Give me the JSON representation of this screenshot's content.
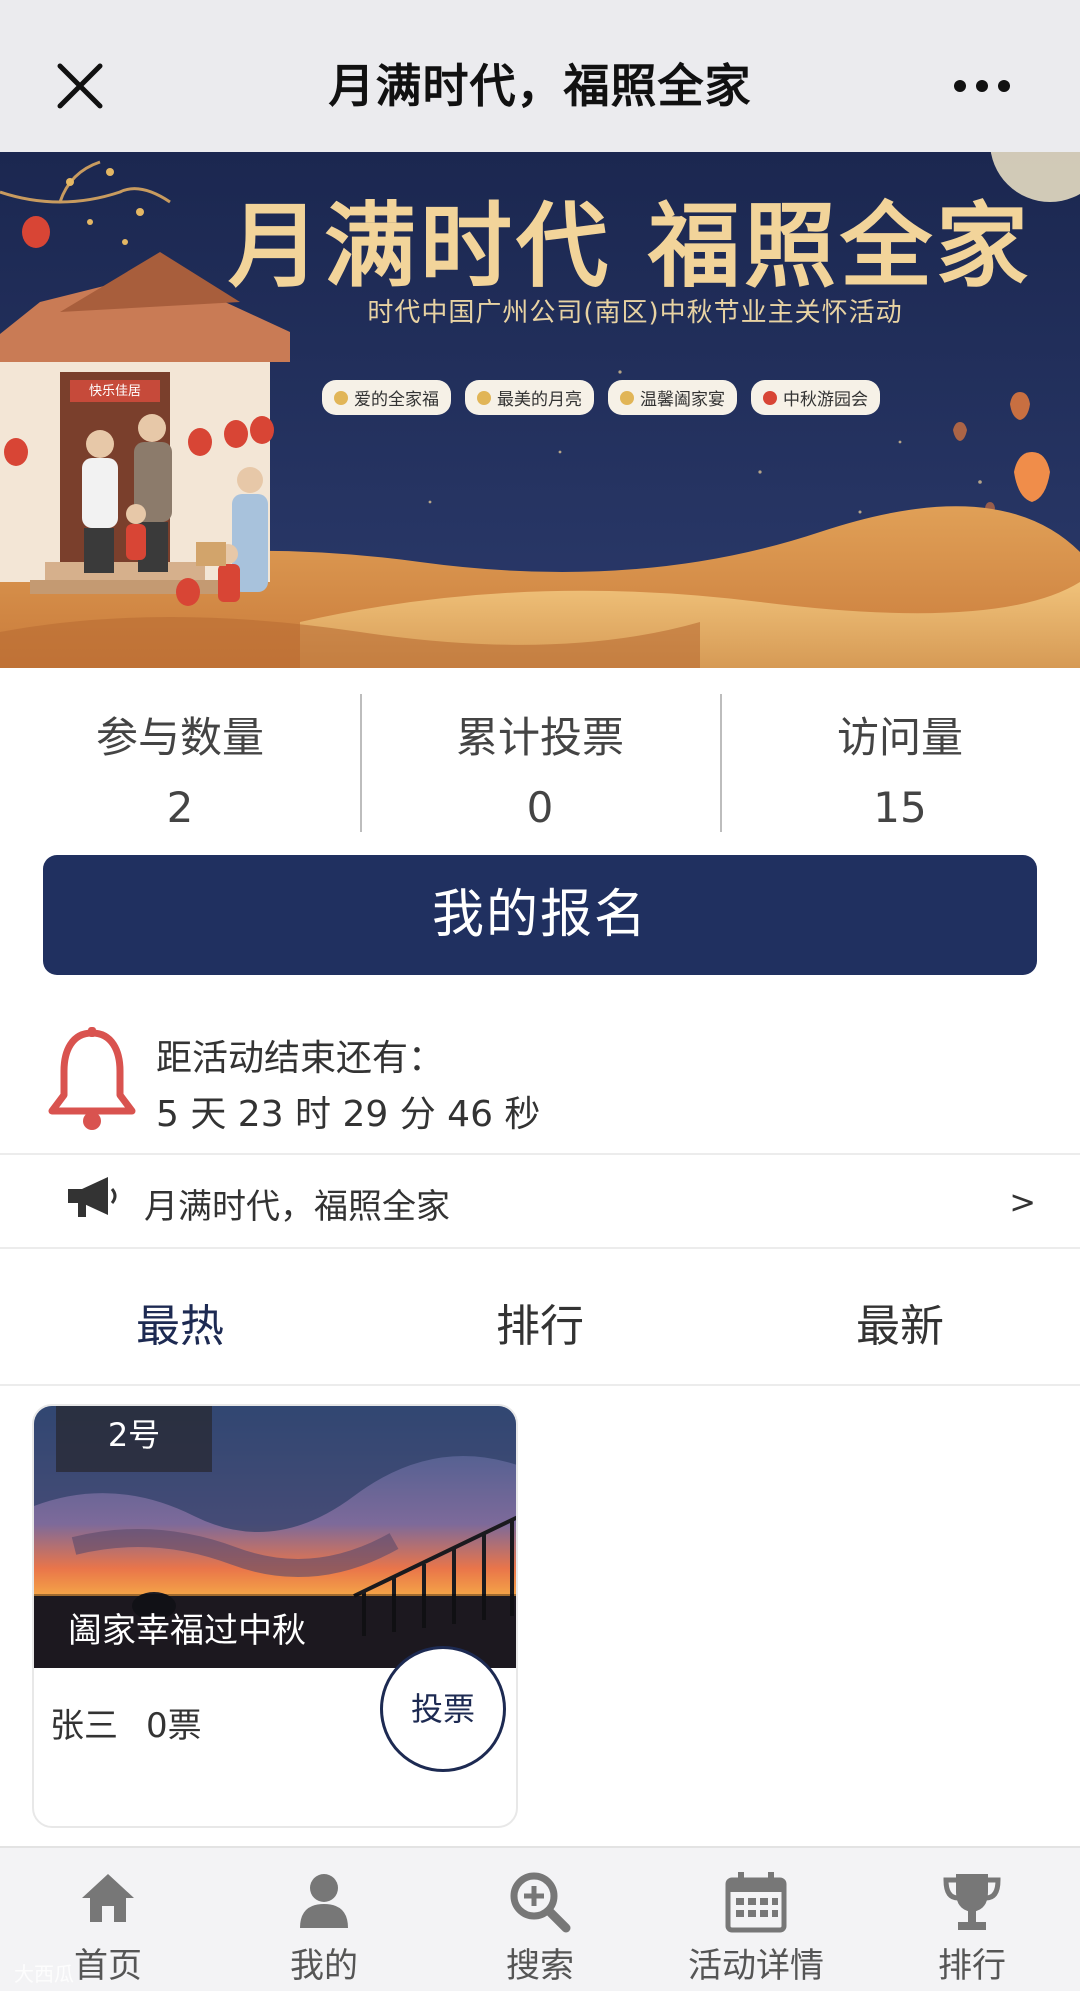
{
  "header": {
    "title": "月满时代，福照全家",
    "close_icon": "close-icon",
    "more_icon": "more-dots-icon"
  },
  "banner": {
    "title": "月满时代 福照全家",
    "subtitle": "时代中国广州公司(南区)中秋节业主关怀活动",
    "chips": [
      "爱的全家福",
      "最美的月亮",
      "温馨阖家宴",
      "中秋游园会"
    ],
    "door_sign": "快乐佳居"
  },
  "stats": [
    {
      "label": "参与数量",
      "value": "2"
    },
    {
      "label": "累计投票",
      "value": "0"
    },
    {
      "label": "访问量",
      "value": "15"
    }
  ],
  "signup_button": "我的报名",
  "countdown": {
    "label": "距活动结束还有：",
    "time": "5 天 23 时 29 分 46 秒"
  },
  "notice": {
    "text": "月满时代，福照全家",
    "arrow": ">"
  },
  "tabs": [
    {
      "label": "最热",
      "active": true
    },
    {
      "label": "排行",
      "active": false
    },
    {
      "label": "最新",
      "active": false
    }
  ],
  "entries": [
    {
      "number": "2号",
      "caption": "阖家幸福过中秋",
      "owner": "张三",
      "votes": "0票",
      "vote_button": "投票"
    }
  ],
  "bottom_nav": [
    {
      "label": "首页",
      "icon": "home-icon"
    },
    {
      "label": "我的",
      "icon": "user-icon"
    },
    {
      "label": "搜索",
      "icon": "search-icon"
    },
    {
      "label": "活动详情",
      "icon": "calendar-icon"
    },
    {
      "label": "排行",
      "icon": "trophy-icon"
    }
  ],
  "watermark": "大西瓜",
  "colors": {
    "primary": "#203060",
    "bell": "#d9534f",
    "banner_bg": "#1d2a52",
    "gold": "#f2d49a"
  }
}
